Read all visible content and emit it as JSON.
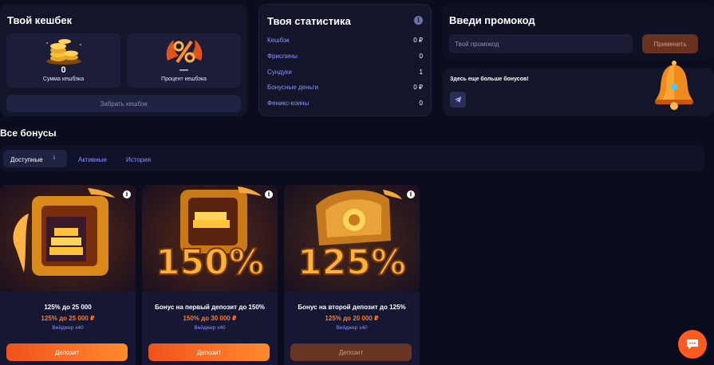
{
  "cashback": {
    "title": "Твой кешбек",
    "amount_value": "0",
    "amount_label": "Сумма кешбэка",
    "percent_value": "—",
    "percent_label": "Процент кешбэка",
    "withdraw_label": "Забрать кешбэк"
  },
  "stats": {
    "title": "Твоя статистика",
    "rows": [
      {
        "label": "Кешбэк",
        "value": "0 ₽"
      },
      {
        "label": "Фриспины",
        "value": "0"
      },
      {
        "label": "Сундуки",
        "value": "1"
      },
      {
        "label": "Бонусные деньги",
        "value": "0 ₽"
      },
      {
        "label": "Феникс-коины",
        "value": "0"
      }
    ]
  },
  "promo": {
    "title": "Введи промокод",
    "placeholder": "Твой промокод",
    "apply_label": "Применить"
  },
  "more_bonuses": {
    "text": "Здесь еще больше бонусов!"
  },
  "bonuses": {
    "title": "Все бонусы",
    "tabs": [
      {
        "label": "Доступные",
        "count": "3"
      },
      {
        "label": "Активные"
      },
      {
        "label": "История"
      }
    ],
    "cards": [
      {
        "title": "125% до 25 000",
        "amount": "125% до 25 000 ₽",
        "wager": "Вейджер x40",
        "button": "Депозит",
        "art_text": ""
      },
      {
        "title": "Бонус на первый депозит до 150%",
        "amount": "150% до 30 000 ₽",
        "wager": "Вейджер x40",
        "button": "Депозит",
        "art_text": "150%"
      },
      {
        "title": "Бонус на второй депозит до 125%",
        "amount": "125% до 20 000 ₽",
        "wager": "Вейджер x40",
        "button": "Депозит",
        "art_text": "125%"
      }
    ]
  },
  "colors": {
    "accent": "#ff6a1f",
    "link": "#8f93ff",
    "background": "#0b0d1e",
    "panel": "#13152b"
  }
}
